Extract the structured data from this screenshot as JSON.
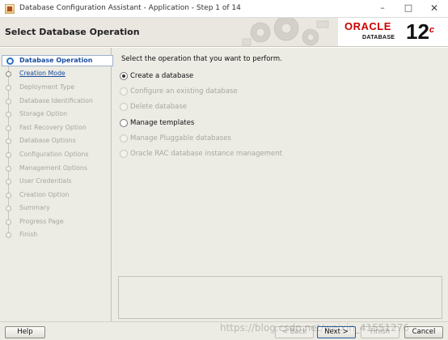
{
  "window": {
    "title": "Database Configuration Assistant - Application - Step 1 of 14",
    "minimize_glyph": "–",
    "maximize_glyph": "□",
    "close_glyph": "✕"
  },
  "header": {
    "page_title": "Select Database Operation",
    "brand": "ORACLE",
    "brand_sub": "DATABASE",
    "version": "12",
    "version_suffix": "c",
    "brand_color": "#cc0000"
  },
  "steps": [
    {
      "label": "Database Operation",
      "state": "current"
    },
    {
      "label": "Creation Mode",
      "state": "link"
    },
    {
      "label": "Deployment Type",
      "state": "disabled"
    },
    {
      "label": "Database Identification",
      "state": "disabled"
    },
    {
      "label": "Storage Option",
      "state": "disabled"
    },
    {
      "label": "Fast Recovery Option",
      "state": "disabled"
    },
    {
      "label": "Database Options",
      "state": "disabled"
    },
    {
      "label": "Configuration Options",
      "state": "disabled"
    },
    {
      "label": "Management Options",
      "state": "disabled"
    },
    {
      "label": "User Credentials",
      "state": "disabled"
    },
    {
      "label": "Creation Option",
      "state": "disabled"
    },
    {
      "label": "Summary",
      "state": "disabled"
    },
    {
      "label": "Progress Page",
      "state": "disabled"
    },
    {
      "label": "Finish",
      "state": "disabled"
    }
  ],
  "main": {
    "instructions": "Select the operation that you want to perform.",
    "options": [
      {
        "label": "Create a database",
        "selected": true,
        "enabled": true
      },
      {
        "label": "Configure an existing database",
        "selected": false,
        "enabled": false
      },
      {
        "label": "Delete database",
        "selected": false,
        "enabled": false
      },
      {
        "label": "Manage templates",
        "selected": false,
        "enabled": true
      },
      {
        "label": "Manage Pluggable databases",
        "selected": false,
        "enabled": false
      },
      {
        "label": "Oracle RAC database instance management",
        "selected": false,
        "enabled": false
      }
    ]
  },
  "footer": {
    "help": "Help",
    "back": "< Back",
    "next": "Next >",
    "finish": "Finish",
    "cancel": "Cancel"
  },
  "watermark": "https://blog.csdn.net/weixin_41551276"
}
